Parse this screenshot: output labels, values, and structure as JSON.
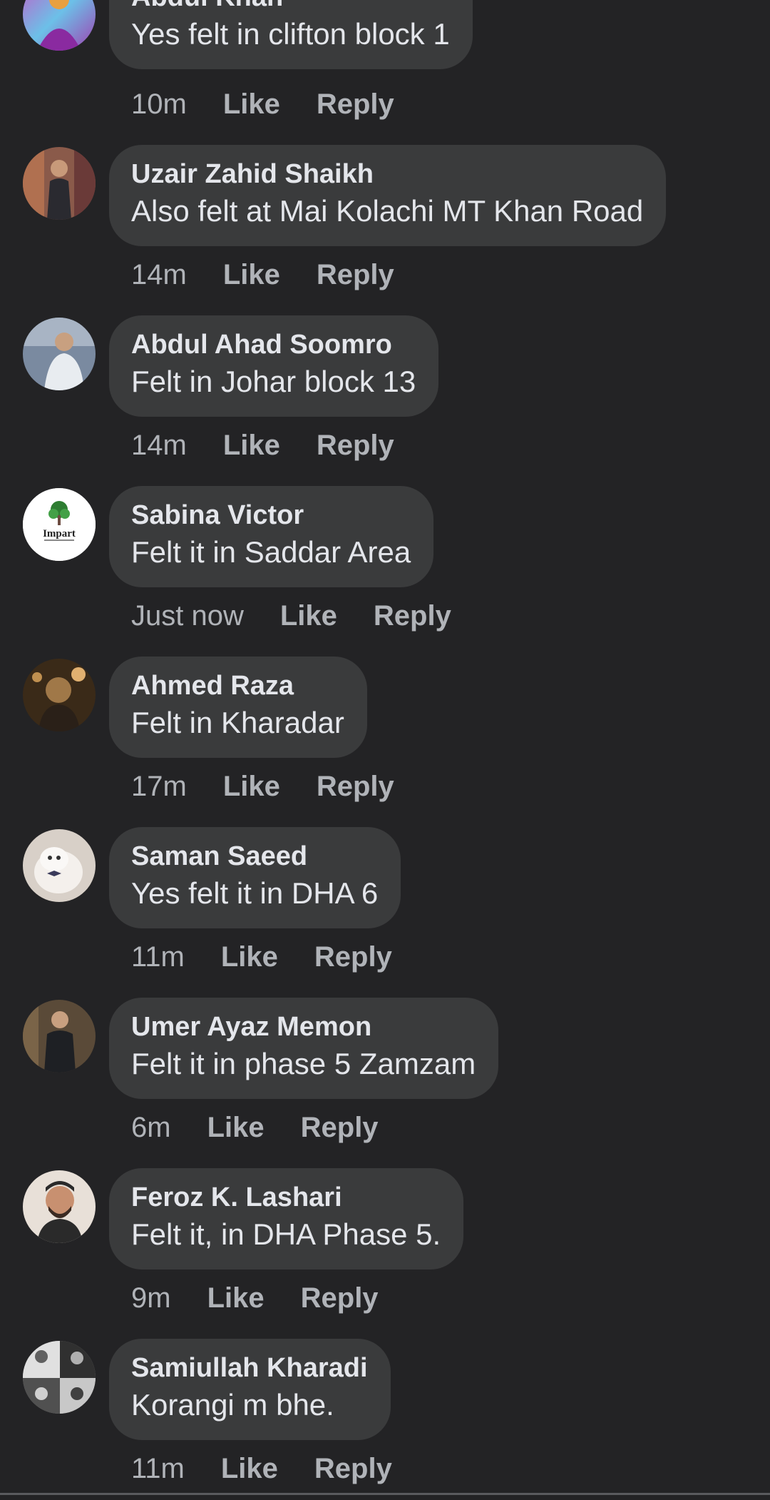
{
  "comments": [
    {
      "author": "Abdul Khan",
      "text": "Yes felt in clifton block 1",
      "time": "10m",
      "like": "Like",
      "reply": "Reply",
      "avatar": {
        "icon": "avatar-colorful",
        "colors": [
          "#c060c8",
          "#6cc0e8",
          "#e8a040"
        ]
      }
    },
    {
      "author": "Uzair Zahid Shaikh",
      "text": "Also felt at Mai Kolachi MT Khan Road",
      "time": "14m",
      "like": "Like",
      "reply": "Reply",
      "avatar": {
        "icon": "avatar-person-indoor",
        "colors": [
          "#8a5a4a",
          "#2a2a30",
          "#c89a7a"
        ]
      }
    },
    {
      "author": "Abdul Ahad Soomro",
      "text": "Felt in Johar block 13",
      "time": "14m",
      "like": "Like",
      "reply": "Reply",
      "avatar": {
        "icon": "avatar-person-white-shirt",
        "colors": [
          "#7a8aa0",
          "#e8ecf0",
          "#c8a080"
        ]
      }
    },
    {
      "author": "Sabina Victor",
      "text": "Felt it in Saddar Area",
      "time": "Just now",
      "like": "Like",
      "reply": "Reply",
      "avatar": {
        "icon": "avatar-impart-logo",
        "logo_text": "Impart",
        "colors": [
          "#ffffff",
          "#2e7d32",
          "#222222"
        ]
      }
    },
    {
      "author": "Ahmed Raza",
      "text": "Felt in Kharadar",
      "time": "17m",
      "like": "Like",
      "reply": "Reply",
      "avatar": {
        "icon": "avatar-person-dark",
        "colors": [
          "#3a2a18",
          "#a07848",
          "#e0b070"
        ]
      }
    },
    {
      "author": "Saman Saeed",
      "text": "Yes felt it in DHA 6",
      "time": "11m",
      "like": "Like",
      "reply": "Reply",
      "avatar": {
        "icon": "avatar-white-cat",
        "colors": [
          "#d8d0c8",
          "#f4f0ec",
          "#3a3a5a"
        ]
      }
    },
    {
      "author": "Umer Ayaz Memon",
      "text": "Felt it in phase 5 Zamzam",
      "time": "6m",
      "like": "Like",
      "reply": "Reply",
      "avatar": {
        "icon": "avatar-person-suit",
        "colors": [
          "#5a4a38",
          "#1e2024",
          "#c8a080"
        ]
      }
    },
    {
      "author": "Feroz K. Lashari",
      "text": "Felt it, in DHA Phase 5.",
      "time": "9m",
      "like": "Like",
      "reply": "Reply",
      "avatar": {
        "icon": "avatar-person-beard",
        "colors": [
          "#e8e0d8",
          "#2a2a2a",
          "#c89070"
        ]
      }
    },
    {
      "author": "Samiullah Kharadi",
      "text": "Korangi m bhe.",
      "time": "11m",
      "like": "Like",
      "reply": "Reply",
      "avatar": {
        "icon": "avatar-collage-bw",
        "colors": [
          "#e0e0e0",
          "#303030",
          "#909090"
        ]
      }
    }
  ]
}
